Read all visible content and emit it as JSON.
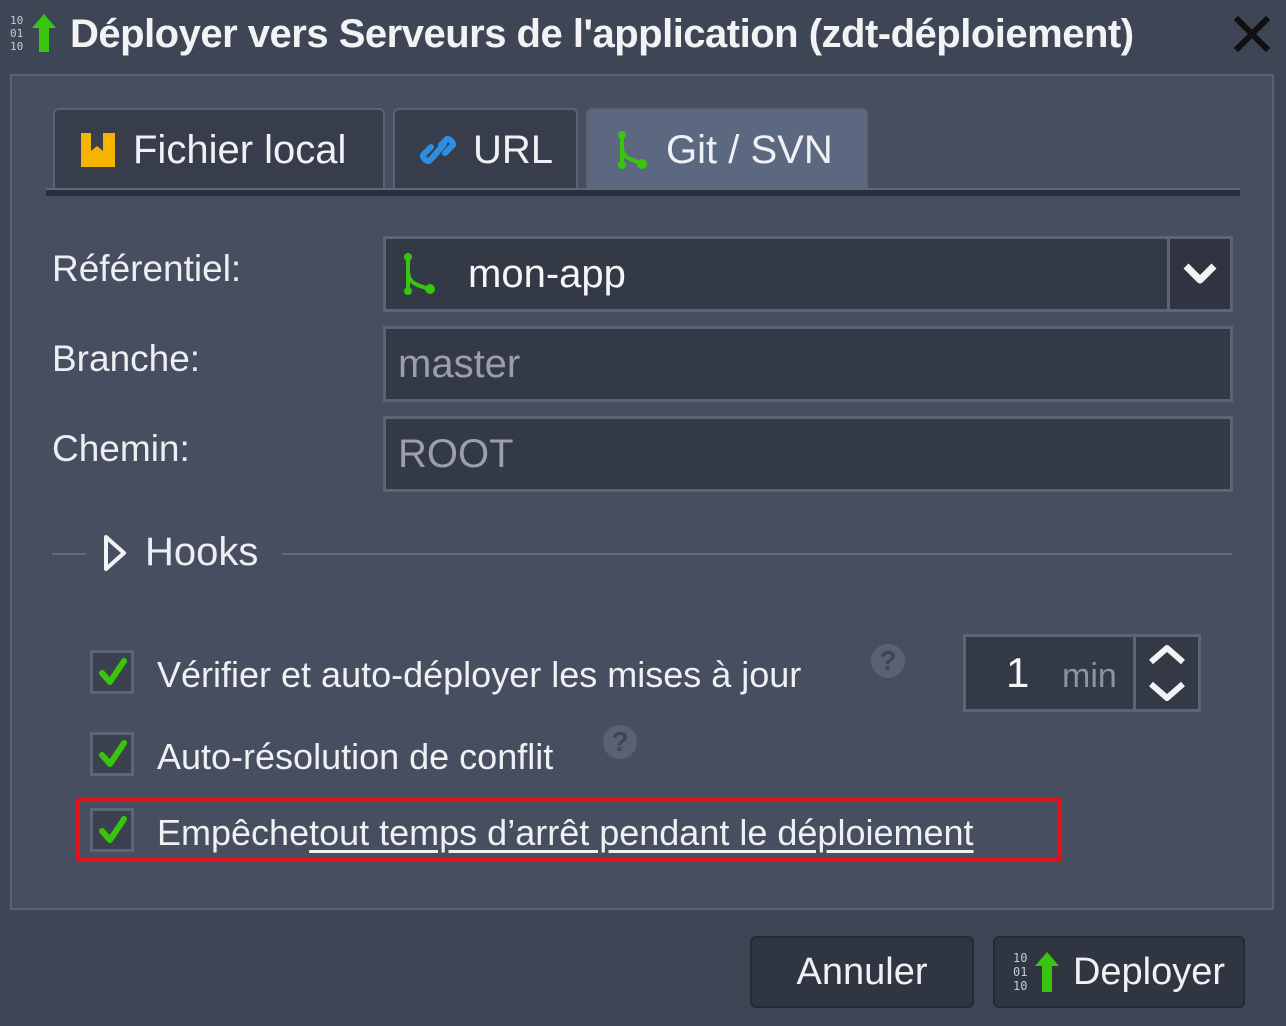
{
  "dialog": {
    "title": "Déployer vers Serveurs de l'application (zdt-déploiement)"
  },
  "tabs": [
    {
      "label": "Fichier local",
      "icon": "local-file-icon",
      "active": false
    },
    {
      "label": "URL",
      "icon": "link-icon",
      "active": false
    },
    {
      "label": "Git / SVN",
      "icon": "git-icon",
      "active": true
    }
  ],
  "form": {
    "repository": {
      "label": "Référentiel:",
      "value": "mon-app"
    },
    "branch": {
      "label": "Branche:",
      "placeholder": "master"
    },
    "path": {
      "label": "Chemin:",
      "placeholder": "ROOT"
    }
  },
  "hooks": {
    "label": "Hooks"
  },
  "options": {
    "auto_update": {
      "label": "Vérifier et auto-déployer les mises à jour",
      "checked": true,
      "help": "?"
    },
    "interval": {
      "value": "1",
      "unit": "min"
    },
    "auto_resolve": {
      "label": "Auto-résolution de conflit",
      "checked": true,
      "help": "?"
    },
    "zero_downtime": {
      "label_start": "Empêche",
      "label_link": "tout temps d’arrêt pendant le déploiement",
      "checked": true
    }
  },
  "footer": {
    "cancel_label": "Annuler",
    "deploy_label": "Deployer"
  },
  "colors": {
    "accent_green": "#39c40e",
    "highlight_red": "#e0121b",
    "active_tab": "#5c6880"
  }
}
